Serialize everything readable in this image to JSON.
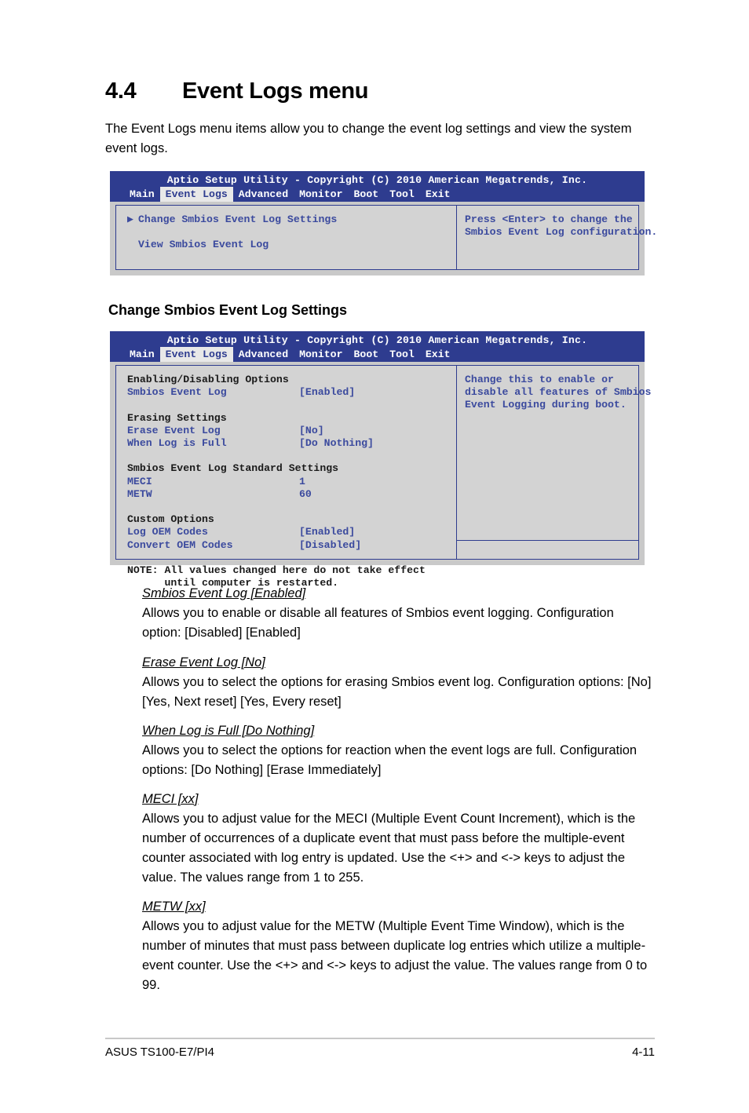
{
  "section": {
    "number": "4.4",
    "title": "Event Logs menu",
    "intro": "The Event Logs menu items allow you to change the event log settings and view the system event logs."
  },
  "subheading_change": "Change Smbios Event Log Settings",
  "colors": {
    "bios_blue": "#2e3c8f",
    "bios_text_blue": "#3b4a9e",
    "bios_panel_gray": "#d3d3d3",
    "bios_frame_gray": "#c9c9c9"
  },
  "bios_screen_1": {
    "title": "Aptio Setup Utility - Copyright (C) 2010 American Megatrends, Inc.",
    "menu": [
      {
        "label": "Main",
        "active": false
      },
      {
        "label": "Event Logs",
        "active": true
      },
      {
        "label": "Advanced",
        "active": false
      },
      {
        "label": "Monitor",
        "active": false
      },
      {
        "label": "Boot",
        "active": false
      },
      {
        "label": "Tool",
        "active": false
      },
      {
        "label": "Exit",
        "active": false
      }
    ],
    "items": [
      {
        "arrow": "▶",
        "label": "Change Smbios Event Log Settings"
      },
      {
        "arrow": "",
        "label": "View Smbios Event Log"
      }
    ],
    "help": "Press <Enter> to change the\nSmbios Event Log configuration."
  },
  "bios_screen_2": {
    "title": "Aptio Setup Utility - Copyright (C) 2010 American Megatrends, Inc.",
    "menu": [
      {
        "label": "Main",
        "active": false
      },
      {
        "label": "Event Logs",
        "active": true
      },
      {
        "label": "Advanced",
        "active": false
      },
      {
        "label": "Monitor",
        "active": false
      },
      {
        "label": "Boot",
        "active": false
      },
      {
        "label": "Tool",
        "active": false
      },
      {
        "label": "Exit",
        "active": false
      }
    ],
    "groups": [
      {
        "header": "Enabling/Disabling Options",
        "rows": [
          {
            "label": "Smbios Event Log",
            "value": "[Enabled]"
          }
        ]
      },
      {
        "header": "Erasing Settings",
        "rows": [
          {
            "label": "Erase Event Log",
            "value": "[No]"
          },
          {
            "label": "When Log is Full",
            "value": "[Do Nothing]"
          }
        ]
      },
      {
        "header": "Smbios Event Log Standard Settings",
        "rows": [
          {
            "label": "MECI",
            "value": "1"
          },
          {
            "label": "METW",
            "value": "60"
          }
        ]
      },
      {
        "header": "Custom Options",
        "rows": [
          {
            "label": "Log OEM Codes",
            "value": "[Enabled]"
          },
          {
            "label": "Convert OEM Codes",
            "value": "[Disabled]"
          }
        ]
      }
    ],
    "note_line1": "NOTE: All values changed here do not take effect",
    "note_line2": "      until computer is restarted.",
    "help": "Change this to enable or\ndisable all features of Smbios\nEvent Logging during boot."
  },
  "descriptions": [
    {
      "title": "Smbios Event Log [Enabled]",
      "body": "Allows you to enable or disable all features of Smbios event logging. Configuration option: [Disabled] [Enabled]"
    },
    {
      "title": "Erase Event Log [No]",
      "body": "Allows you to select the options for erasing Smbios event log. Configuration options: [No] [Yes, Next reset] [Yes, Every reset]"
    },
    {
      "title": "When Log is Full [Do Nothing]",
      "body": "Allows you to select the options for reaction when the event logs are full. Configuration options: [Do Nothing] [Erase Immediately]"
    },
    {
      "title": "MECI [xx]",
      "body": "Allows you to adjust value for the MECI (Multiple Event Count Increment), which is the number of occurrences of a duplicate event that must pass before the multiple-event counter associated with log entry is updated. Use the <+> and <-> keys to adjust the value. The values range from 1 to 255."
    },
    {
      "title": "METW [xx]",
      "body": "Allows you to adjust value for the METW (Multiple Event Time Window), which is the number of minutes that must pass between duplicate log entries which utilize a multiple-event counter. Use the <+> and <-> keys to adjust the value. The values range from 0 to 99."
    }
  ],
  "footer": {
    "left": "ASUS TS100-E7/PI4",
    "right": "4-11"
  }
}
